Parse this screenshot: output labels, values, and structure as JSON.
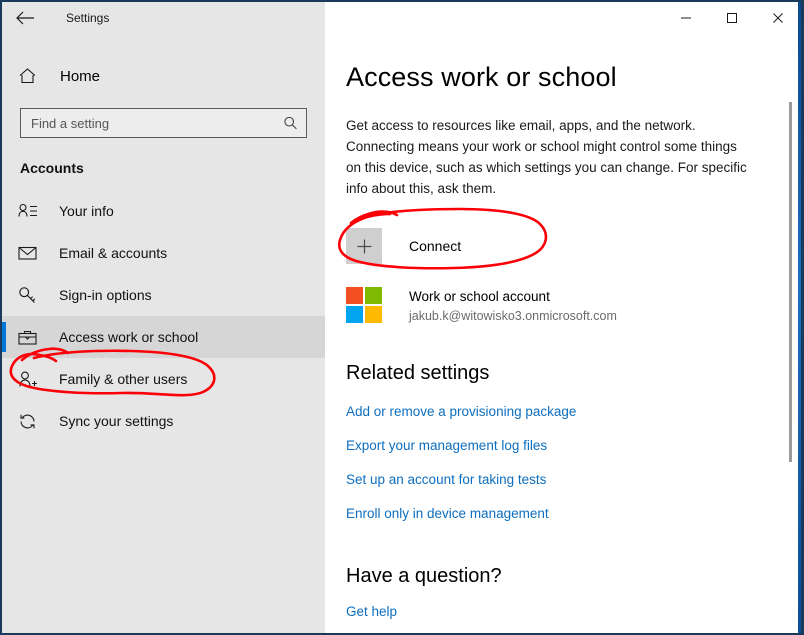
{
  "window": {
    "title": "Settings",
    "back_icon": "back-arrow-icon",
    "controls": {
      "minimize": "minimize-icon",
      "maximize": "maximize-icon",
      "close": "close-icon"
    }
  },
  "sidebar": {
    "home": {
      "label": "Home",
      "icon": "home-icon"
    },
    "search": {
      "placeholder": "Find a setting",
      "value": "",
      "icon": "search-icon"
    },
    "section": "Accounts",
    "items": [
      {
        "label": "Your info",
        "icon": "user-info-icon",
        "selected": false
      },
      {
        "label": "Email & accounts",
        "icon": "envelope-icon",
        "selected": false
      },
      {
        "label": "Sign-in options",
        "icon": "key-icon",
        "selected": false
      },
      {
        "label": "Access work or school",
        "icon": "briefcase-icon",
        "selected": true
      },
      {
        "label": "Family & other users",
        "icon": "user-plus-icon",
        "selected": false
      },
      {
        "label": "Sync your settings",
        "icon": "sync-icon",
        "selected": false
      }
    ]
  },
  "main": {
    "title": "Access work or school",
    "description": "Get access to resources like email, apps, and the network. Connecting means your work or school might control some things on this device, such as which settings you can change. For specific info about this, ask them.",
    "connect": {
      "label": "Connect",
      "icon": "plus-icon"
    },
    "account": {
      "icon": "microsoft-logo-icon",
      "name": "Work or school account",
      "email": "jakub.k@witowisko3.onmicrosoft.com"
    },
    "related": {
      "heading": "Related settings",
      "links": [
        "Add or remove a provisioning package",
        "Export your management log files",
        "Set up an account for taking tests",
        "Enroll only in device management"
      ]
    },
    "question": {
      "heading": "Have a question?",
      "link": "Get help"
    }
  },
  "colors": {
    "accent": "#0078d7",
    "link": "#0d6ebf",
    "sidebar_bg": "#e6e6e6",
    "annotation": "#fb0007",
    "ms_red": "#f25022",
    "ms_green": "#7fba00",
    "ms_blue": "#00a4ef",
    "ms_yellow": "#ffb900"
  },
  "annotations": [
    {
      "name": "connect-highlight",
      "shape": "hand-drawn-ellipse"
    },
    {
      "name": "access-work-or-school-highlight",
      "shape": "hand-drawn-ellipse"
    }
  ]
}
